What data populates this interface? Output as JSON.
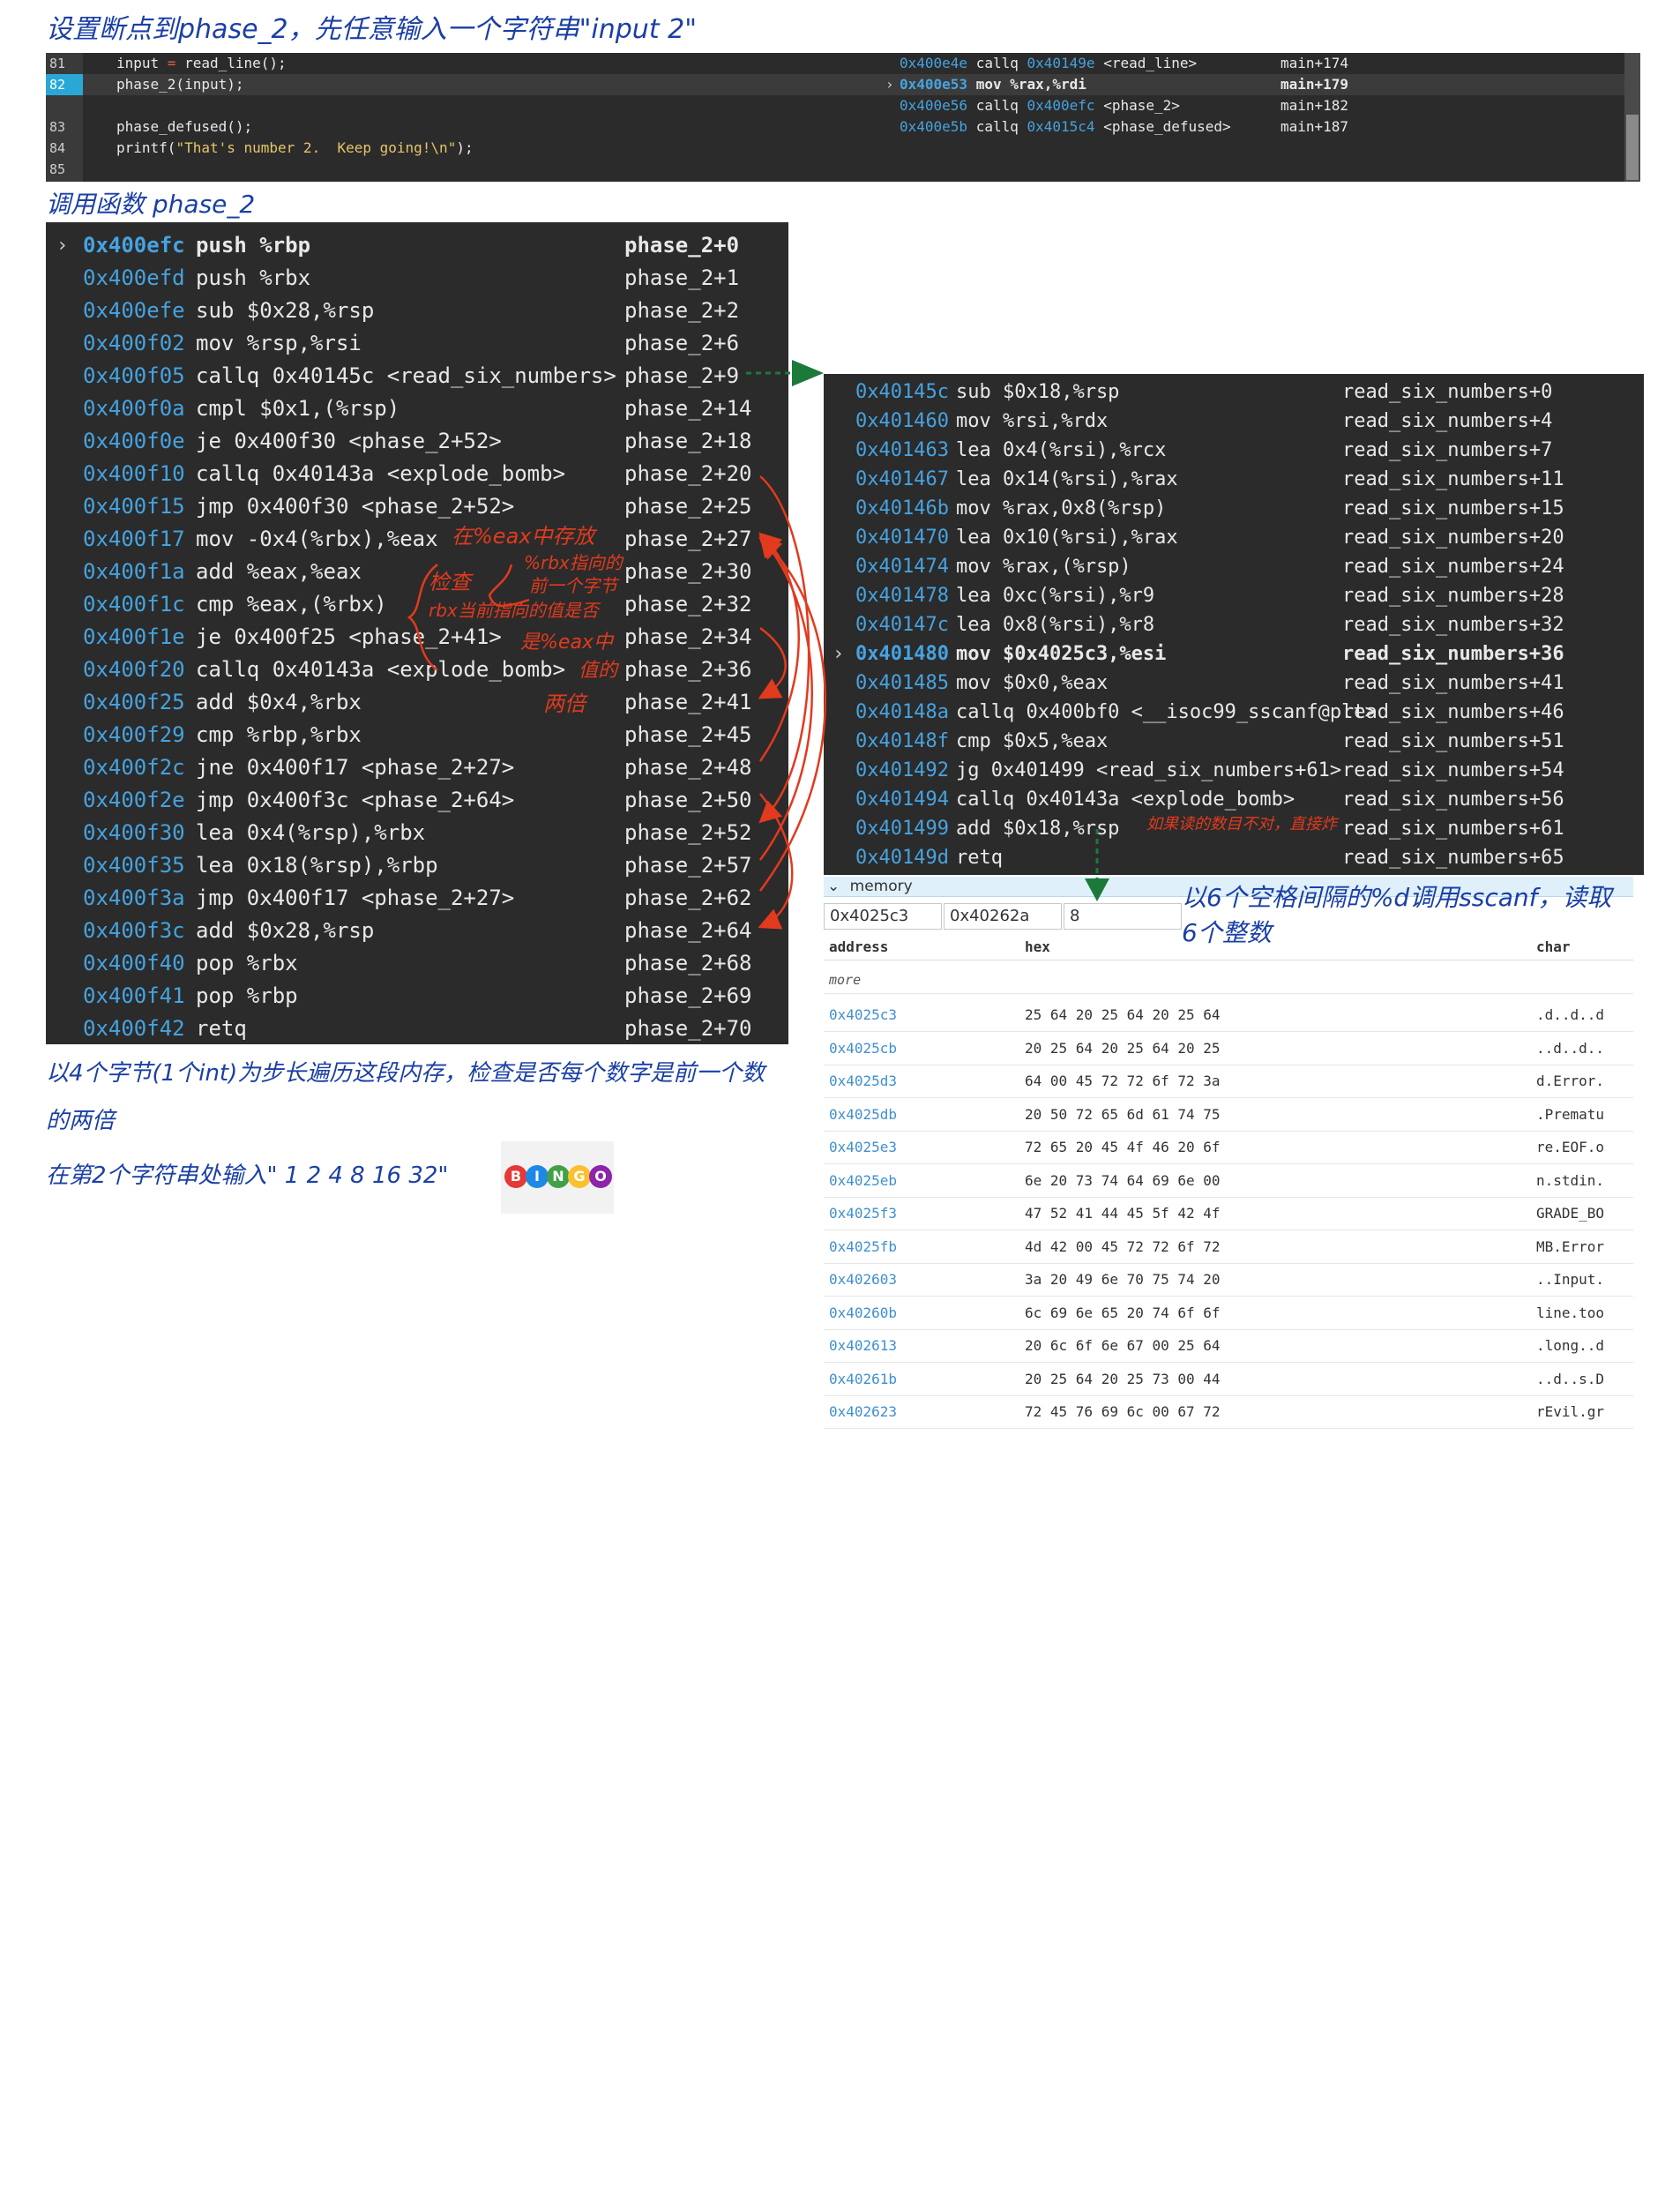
{
  "notes": {
    "title": "设置断点到phase_2，先任意输入一个字符串\"input 2\"",
    "call_phase2": "调用函数 phase_2",
    "explain_line1": "以4个字节(1个int)为步长遍历这段内存，检查是否每个数字是前一个数",
    "explain_line2": "的两倍",
    "answer": "在第2个字符串处输入\" 1  2  4  8  16  32\"",
    "sscanf_line1": "以6个空格间隔的%d调用sscanf，读取",
    "sscanf_line2": "6个整数",
    "red_eax": "在%eax中存放",
    "red_rbx1": "%rbx指向的",
    "red_rbx2": "前一个字节",
    "red_check": "检查",
    "red_rbx3": "rbx当前指向的值是否",
    "red_rbx4": "是%eax中",
    "red_rbx5": "值的",
    "red_rbx6": "两倍",
    "red_sscanf": "如果读的数目不对，直接炸",
    "bingo": [
      "B",
      "I",
      "N",
      "G",
      "O"
    ],
    "bingo_colors": [
      "#e53935",
      "#1e88e5",
      "#43a047",
      "#fbc02d",
      "#8e24aa"
    ]
  },
  "source": {
    "line_numbers": [
      "81",
      "82",
      "83",
      "84",
      "85"
    ],
    "lines": [
      {
        "pre": "input ",
        "op": "=",
        "post": " read_line();"
      },
      {
        "pre": "phase_2(input);",
        "op": "",
        "post": ""
      },
      {
        "pre": "",
        "op": "",
        "post": ""
      },
      {
        "pre": "phase_defused();",
        "op": "",
        "post": ""
      },
      {
        "pre": "printf(",
        "str": "\"That's number 2.  Keep going!\\n\"",
        "post": ");"
      }
    ],
    "asm": [
      {
        "addr": "0x400e4e",
        "instr": "callq ",
        "target": "0x40149e",
        "rest": " <read_line>",
        "sym": "main+174",
        "current": false
      },
      {
        "addr": "0x400e53",
        "instr": "mov %rax,%rdi",
        "target": "",
        "rest": "",
        "sym": "main+179",
        "current": true
      },
      {
        "addr": "0x400e56",
        "instr": "callq ",
        "target": "0x400efc",
        "rest": " <phase_2>",
        "sym": "main+182",
        "current": false
      },
      {
        "addr": "0x400e5b",
        "instr": "callq ",
        "target": "0x4015c4",
        "rest": " <phase_defused>",
        "sym": "main+187",
        "current": false
      }
    ]
  },
  "phase2": [
    {
      "addr": "0x400efc",
      "instr": "push %rbp",
      "sym": "phase_2+0",
      "current": true
    },
    {
      "addr": "0x400efd",
      "instr": "push %rbx",
      "sym": "phase_2+1"
    },
    {
      "addr": "0x400efe",
      "instr": "sub $0x28,%rsp",
      "sym": "phase_2+2"
    },
    {
      "addr": "0x400f02",
      "instr": "mov %rsp,%rsi",
      "sym": "phase_2+6"
    },
    {
      "addr": "0x400f05",
      "instr": "callq 0x40145c <read_six_numbers>",
      "sym": "phase_2+9"
    },
    {
      "addr": "0x400f0a",
      "instr": "cmpl $0x1,(%rsp)",
      "sym": "phase_2+14"
    },
    {
      "addr": "0x400f0e",
      "instr": "je 0x400f30 <phase_2+52>",
      "sym": "phase_2+18"
    },
    {
      "addr": "0x400f10",
      "instr": "callq 0x40143a <explode_bomb>",
      "sym": "phase_2+20"
    },
    {
      "addr": "0x400f15",
      "instr": "jmp 0x400f30 <phase_2+52>",
      "sym": "phase_2+25"
    },
    {
      "addr": "0x400f17",
      "instr": "mov -0x4(%rbx),%eax",
      "sym": "phase_2+27"
    },
    {
      "addr": "0x400f1a",
      "instr": "add %eax,%eax",
      "sym": "phase_2+30"
    },
    {
      "addr": "0x400f1c",
      "instr": "cmp %eax,(%rbx)",
      "sym": "phase_2+32"
    },
    {
      "addr": "0x400f1e",
      "instr": "je 0x400f25 <phase_2+41>",
      "sym": "phase_2+34"
    },
    {
      "addr": "0x400f20",
      "instr": "callq 0x40143a <explode_bomb>",
      "sym": "phase_2+36"
    },
    {
      "addr": "0x400f25",
      "instr": "add $0x4,%rbx",
      "sym": "phase_2+41"
    },
    {
      "addr": "0x400f29",
      "instr": "cmp %rbp,%rbx",
      "sym": "phase_2+45"
    },
    {
      "addr": "0x400f2c",
      "instr": "jne 0x400f17 <phase_2+27>",
      "sym": "phase_2+48"
    },
    {
      "addr": "0x400f2e",
      "instr": "jmp 0x400f3c <phase_2+64>",
      "sym": "phase_2+50"
    },
    {
      "addr": "0x400f30",
      "instr": "lea 0x4(%rsp),%rbx",
      "sym": "phase_2+52"
    },
    {
      "addr": "0x400f35",
      "instr": "lea 0x18(%rsp),%rbp",
      "sym": "phase_2+57"
    },
    {
      "addr": "0x400f3a",
      "instr": "jmp 0x400f17 <phase_2+27>",
      "sym": "phase_2+62"
    },
    {
      "addr": "0x400f3c",
      "instr": "add $0x28,%rsp",
      "sym": "phase_2+64"
    },
    {
      "addr": "0x400f40",
      "instr": "pop %rbx",
      "sym": "phase_2+68"
    },
    {
      "addr": "0x400f41",
      "instr": "pop %rbp",
      "sym": "phase_2+69"
    },
    {
      "addr": "0x400f42",
      "instr": "retq",
      "sym": "phase_2+70"
    }
  ],
  "read_six": [
    {
      "addr": "0x40145c",
      "instr": "sub $0x18,%rsp",
      "sym": "read_six_numbers+0"
    },
    {
      "addr": "0x401460",
      "instr": "mov %rsi,%rdx",
      "sym": "read_six_numbers+4"
    },
    {
      "addr": "0x401463",
      "instr": "lea 0x4(%rsi),%rcx",
      "sym": "read_six_numbers+7"
    },
    {
      "addr": "0x401467",
      "instr": "lea 0x14(%rsi),%rax",
      "sym": "read_six_numbers+11"
    },
    {
      "addr": "0x40146b",
      "instr": "mov %rax,0x8(%rsp)",
      "sym": "read_six_numbers+15"
    },
    {
      "addr": "0x401470",
      "instr": "lea 0x10(%rsi),%rax",
      "sym": "read_six_numbers+20"
    },
    {
      "addr": "0x401474",
      "instr": "mov %rax,(%rsp)",
      "sym": "read_six_numbers+24"
    },
    {
      "addr": "0x401478",
      "instr": "lea 0xc(%rsi),%r9",
      "sym": "read_six_numbers+28"
    },
    {
      "addr": "0x40147c",
      "instr": "lea 0x8(%rsi),%r8",
      "sym": "read_six_numbers+32"
    },
    {
      "addr": "0x401480",
      "instr": "mov $0x4025c3,%esi",
      "sym": "read_six_numbers+36",
      "current": true
    },
    {
      "addr": "0x401485",
      "instr": "mov $0x0,%eax",
      "sym": "read_six_numbers+41"
    },
    {
      "addr": "0x40148a",
      "instr": "callq 0x400bf0 <__isoc99_sscanf@plt>",
      "sym": "read_six_numbers+46"
    },
    {
      "addr": "0x40148f",
      "instr": "cmp $0x5,%eax",
      "sym": "read_six_numbers+51"
    },
    {
      "addr": "0x401492",
      "instr": "jg 0x401499 <read_six_numbers+61>",
      "sym": "read_six_numbers+54"
    },
    {
      "addr": "0x401494",
      "instr": "callq 0x40143a <explode_bomb>",
      "sym": "read_six_numbers+56"
    },
    {
      "addr": "0x401499",
      "instr": "add $0x18,%rsp",
      "sym": "read_six_numbers+61"
    },
    {
      "addr": "0x40149d",
      "instr": "retq",
      "sym": "read_six_numbers+65"
    }
  ],
  "memory": {
    "title": "memory",
    "inputs": [
      "0x4025c3",
      "0x40262a",
      "8"
    ],
    "headers": {
      "address": "address",
      "hex": "hex",
      "char": "char"
    },
    "more": "more",
    "rows": [
      {
        "address": "0x4025c3",
        "hex": "25 64 20 25 64 20 25 64",
        "char": ".d..d..d"
      },
      {
        "address": "0x4025cb",
        "hex": "20 25 64 20 25 64 20 25",
        "char": "..d..d.."
      },
      {
        "address": "0x4025d3",
        "hex": "64 00 45 72 72 6f 72 3a",
        "char": "d.Error."
      },
      {
        "address": "0x4025db",
        "hex": "20 50 72 65 6d 61 74 75",
        "char": ".Prematu"
      },
      {
        "address": "0x4025e3",
        "hex": "72 65 20 45 4f 46 20 6f",
        "char": "re.EOF.o"
      },
      {
        "address": "0x4025eb",
        "hex": "6e 20 73 74 64 69 6e 00",
        "char": "n.stdin."
      },
      {
        "address": "0x4025f3",
        "hex": "47 52 41 44 45 5f 42 4f",
        "char": "GRADE_BO"
      },
      {
        "address": "0x4025fb",
        "hex": "4d 42 00 45 72 72 6f 72",
        "char": "MB.Error"
      },
      {
        "address": "0x402603",
        "hex": "3a 20 49 6e 70 75 74 20",
        "char": "..Input."
      },
      {
        "address": "0x40260b",
        "hex": "6c 69 6e 65 20 74 6f 6f",
        "char": "line.too"
      },
      {
        "address": "0x402613",
        "hex": "20 6c 6f 6e 67 00 25 64",
        "char": ".long..d"
      },
      {
        "address": "0x40261b",
        "hex": "20 25 64 20 25 73 00 44",
        "char": "..d..s.D"
      },
      {
        "address": "0x402623",
        "hex": "72 45 76 69 6c 00 67 72",
        "char": "rEvil.gr"
      }
    ]
  }
}
